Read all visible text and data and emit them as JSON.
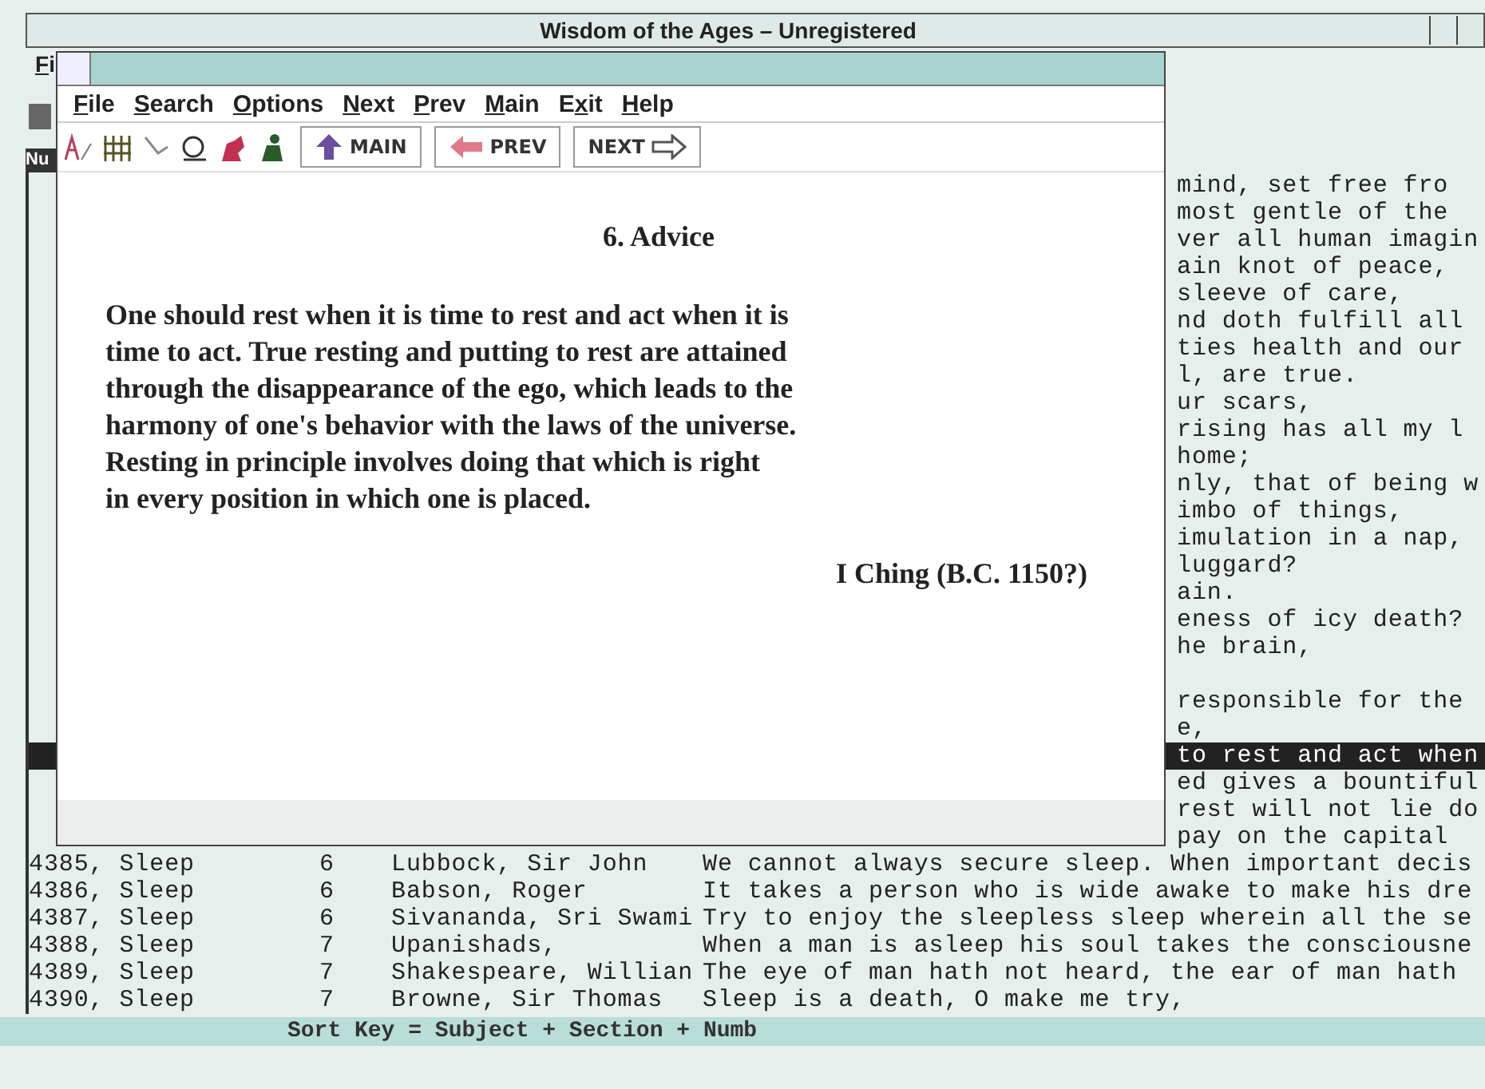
{
  "window": {
    "title": "Wisdom of the Ages – Unregistered"
  },
  "outer_menu": [
    {
      "key": "F",
      "rest": "i"
    }
  ],
  "list_header": "Nu",
  "list": {
    "rows": [
      {
        "fragment": "mind, set free fro",
        "selected": false
      },
      {
        "fragment": "most gentle of the",
        "selected": false
      },
      {
        "fragment": "ver all human imagin",
        "selected": false
      },
      {
        "fragment": "ain knot of peace,",
        "selected": false
      },
      {
        "fragment": "sleeve of care,",
        "selected": false
      },
      {
        "fragment": "nd doth fulfill all",
        "selected": false
      },
      {
        "fragment": "ties health and our",
        "selected": false
      },
      {
        "fragment": "l, are true.",
        "selected": false
      },
      {
        "fragment": "ur scars,",
        "selected": false
      },
      {
        "fragment": "rising has all my l",
        "selected": false
      },
      {
        "fragment": "home;",
        "selected": false
      },
      {
        "fragment": "nly, that of being w",
        "selected": false
      },
      {
        "fragment": "imbo of things,",
        "selected": false
      },
      {
        "fragment": "imulation in a nap,",
        "selected": false
      },
      {
        "fragment": "luggard?",
        "selected": false
      },
      {
        "fragment": "ain.",
        "selected": false
      },
      {
        "fragment": "eness of icy death?",
        "selected": false
      },
      {
        "fragment": "he brain,",
        "selected": false
      },
      {
        "selected": false
      },
      {
        "fragment": "responsible for the",
        "selected": false
      },
      {
        "fragment": "e,",
        "selected": false
      },
      {
        "fragment": "to rest and act when",
        "selected": true
      },
      {
        "fragment": "ed gives a bountiful",
        "selected": false
      },
      {
        "fragment": "rest will not lie do",
        "selected": false
      },
      {
        "fragment": "pay on the capital",
        "selected": false
      },
      {
        "number": "4385, Sleep",
        "section": "6",
        "author": "Lubbock, Sir John",
        "quote": "We cannot always secure sleep.  When important decis",
        "selected": false
      },
      {
        "number": "4386, Sleep",
        "section": "6",
        "author": "Babson, Roger",
        "quote": "It takes a person who is wide awake to make his dre",
        "selected": false
      },
      {
        "number": "4387, Sleep",
        "section": "6",
        "author": "Sivananda, Sri Swami",
        "quote": "Try to enjoy the sleepless sleep wherein all the se",
        "selected": false
      },
      {
        "number": "4388, Sleep",
        "section": "7",
        "author": "Upanishads,",
        "quote": "When a man is asleep his soul takes the consciousne",
        "selected": false
      },
      {
        "number": "4389, Sleep",
        "section": "7",
        "author": "Shakespeare, Willian",
        "quote": "The eye of man hath not heard, the ear of man hath",
        "selected": false
      },
      {
        "number": "4390, Sleep",
        "section": "7",
        "author": "Browne, Sir Thomas",
        "quote": "Sleep is a death, O make me try,",
        "selected": false
      }
    ]
  },
  "status_bar": "Sort Key = Subject + Section + Numb",
  "dialog": {
    "menu": [
      {
        "key": "F",
        "rest": "ile"
      },
      {
        "key": "S",
        "rest": "earch"
      },
      {
        "key": "O",
        "rest": "ptions"
      },
      {
        "key": "N",
        "rest": "ext"
      },
      {
        "key": "P",
        "rest": "rev"
      },
      {
        "key": "M",
        "rest": "ain"
      },
      {
        "pre": "E",
        "key": "x",
        "rest": "it"
      },
      {
        "key": "H",
        "rest": "elp"
      }
    ],
    "toolbar": [
      {
        "kind": "main",
        "label": "MAIN"
      },
      {
        "kind": "prev",
        "label": "PREV"
      },
      {
        "kind": "next",
        "label": "NEXT"
      }
    ],
    "heading": "6. Advice",
    "text": "One should rest when it is time to rest and act when it is\ntime to act.  True resting and putting to rest are attained\nthrough the disappearance of the ego, which leads to the\nharmony of one's behavior with the laws of the universe.\nResting in principle involves doing that which is right\nin every position in which one is placed.",
    "source": "I Ching (B.C. 1150?)"
  }
}
